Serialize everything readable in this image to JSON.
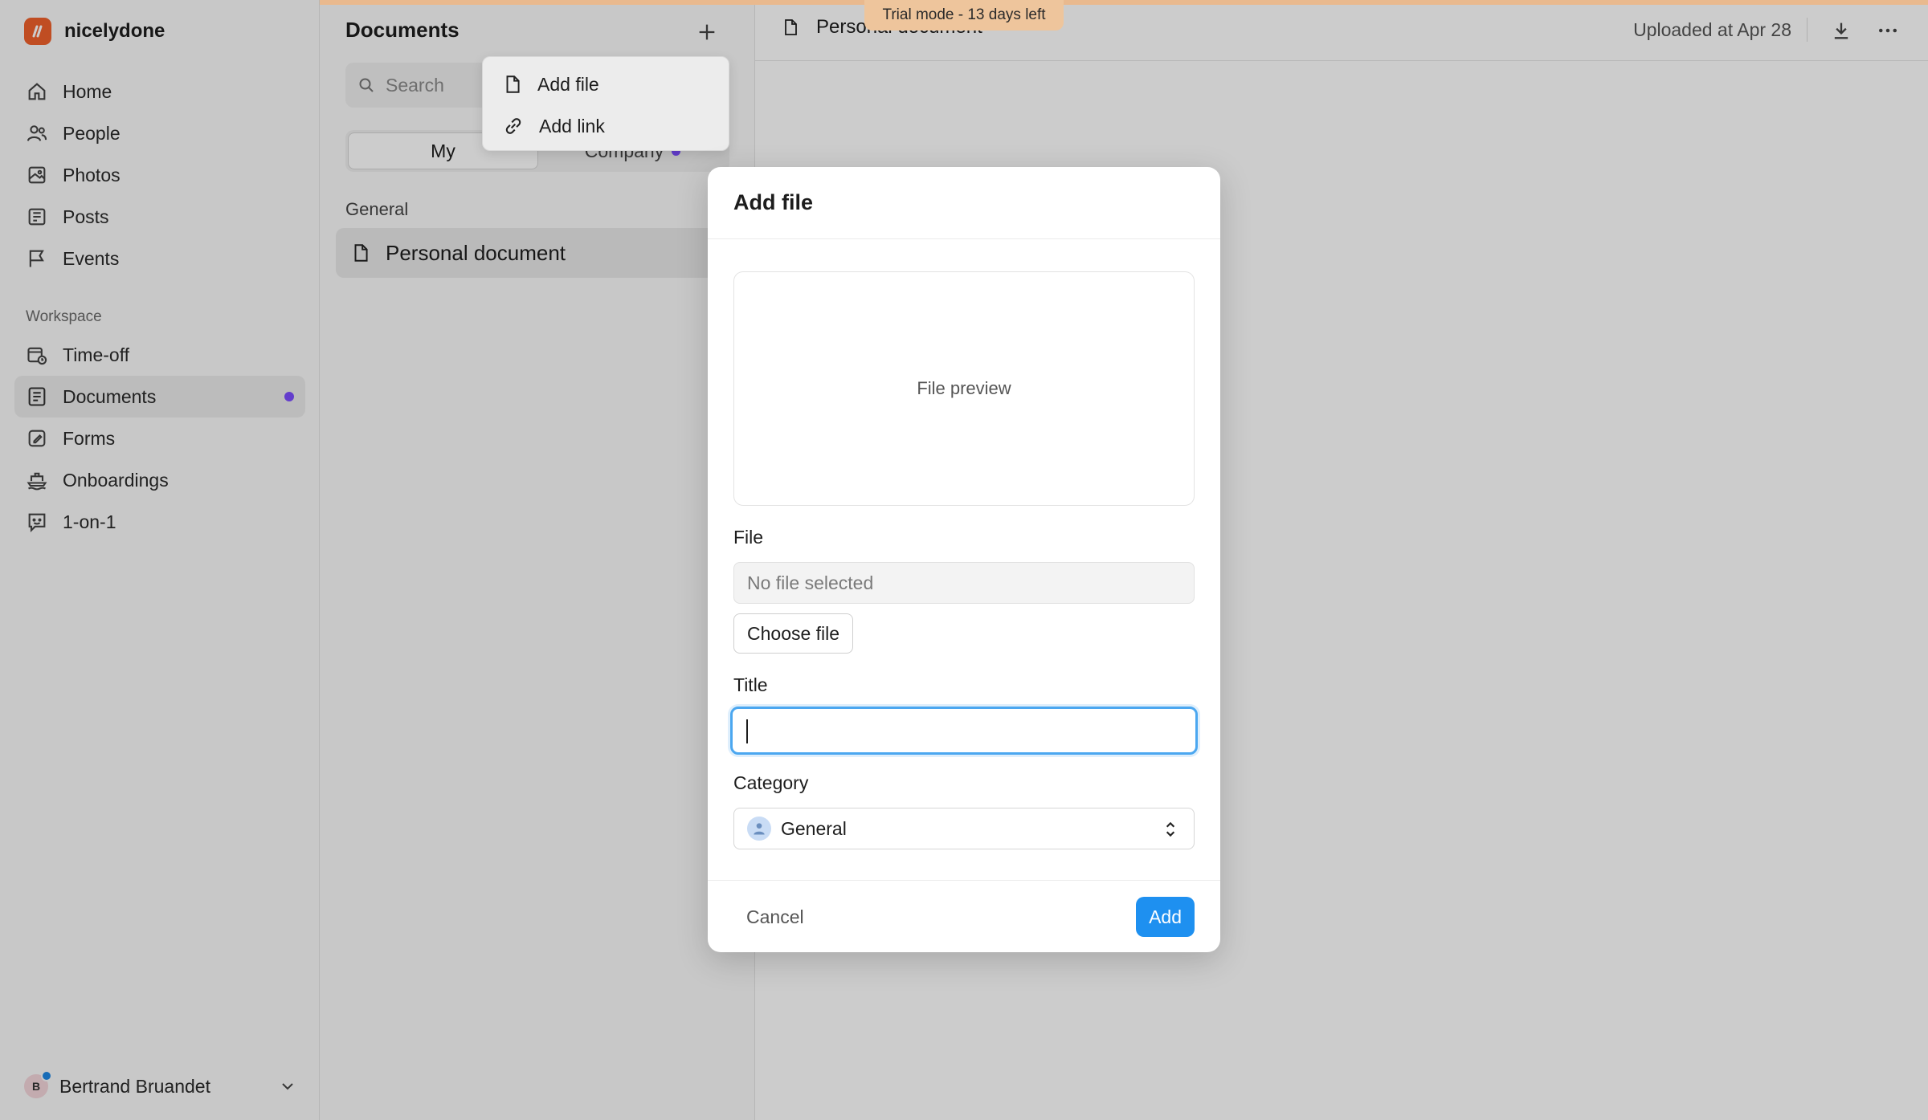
{
  "brand": {
    "name": "nicelydone",
    "logo_color": "#f0612b"
  },
  "sidebar": {
    "primary": [
      {
        "label": "Home",
        "icon": "home-icon"
      },
      {
        "label": "People",
        "icon": "people-icon"
      },
      {
        "label": "Photos",
        "icon": "photos-icon"
      },
      {
        "label": "Posts",
        "icon": "posts-icon"
      },
      {
        "label": "Events",
        "icon": "flag-icon"
      }
    ],
    "section_label": "Workspace",
    "workspace": [
      {
        "label": "Time-off",
        "icon": "calendar-clock-icon"
      },
      {
        "label": "Documents",
        "icon": "documents-icon",
        "active": true,
        "unread": true
      },
      {
        "label": "Forms",
        "icon": "form-edit-icon"
      },
      {
        "label": "Onboardings",
        "icon": "ship-icon"
      },
      {
        "label": "1-on-1",
        "icon": "chat-face-icon"
      }
    ],
    "user": {
      "initial": "B",
      "name": "Bertrand Bruandet"
    }
  },
  "documents_panel": {
    "title": "Documents",
    "search_placeholder": "Search",
    "tabs": [
      {
        "label": "My",
        "selected": true
      },
      {
        "label": "Company",
        "unread": true
      }
    ],
    "group_label": "General",
    "items": [
      {
        "label": "Personal document"
      }
    ]
  },
  "add_menu": {
    "items": [
      {
        "label": "Add file",
        "icon": "file-icon"
      },
      {
        "label": "Add link",
        "icon": "link-icon"
      }
    ]
  },
  "main": {
    "document_title": "Personal document",
    "uploaded_text": "Uploaded at Apr 28"
  },
  "trial": {
    "text": "Trial mode - 13 days left"
  },
  "modal": {
    "title": "Add file",
    "preview_text": "File preview",
    "file_label": "File",
    "file_value": "No file selected",
    "choose_label": "Choose file",
    "title_label": "Title",
    "title_value": "",
    "category_label": "Category",
    "category_value": "General",
    "cancel_label": "Cancel",
    "add_label": "Add"
  },
  "colors": {
    "accent": "#1e90f0",
    "unread_dot": "#7c4dff",
    "trial": "#eec59c"
  }
}
